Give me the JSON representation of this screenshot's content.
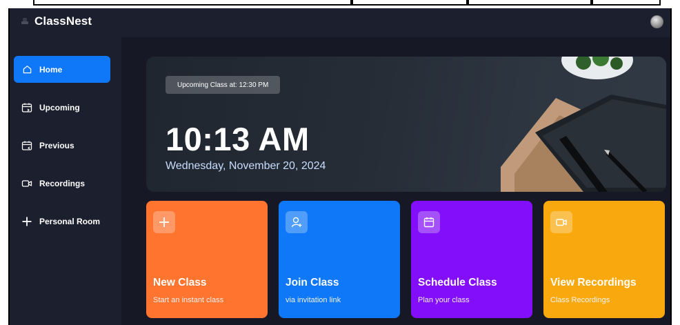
{
  "app": {
    "name": "ClassNest"
  },
  "colors": {
    "background": "#1c1f2e",
    "main_background": "#161925",
    "accent_blue": "#0e78f9",
    "card_orange": "#ff742e",
    "card_blue": "#0e78f9",
    "card_purple": "#830ef9",
    "card_yellow": "#f9a90e"
  },
  "sidebar": {
    "items": [
      {
        "label": "Home",
        "icon": "home-icon"
      },
      {
        "label": "Upcoming",
        "icon": "calendar-upcoming-icon"
      },
      {
        "label": "Previous",
        "icon": "calendar-previous-icon"
      },
      {
        "label": "Recordings",
        "icon": "video-icon"
      },
      {
        "label": "Personal Room",
        "icon": "plus-icon"
      }
    ]
  },
  "hero": {
    "upcoming": "Upcoming Class at: 12:30 PM",
    "time": "10:13 AM",
    "date": "Wednesday, November 20, 2024"
  },
  "cards": [
    {
      "title": "New Class",
      "subtitle": "Start an instant class",
      "icon": "plus-icon"
    },
    {
      "title": "Join Class",
      "subtitle": "via invitation link",
      "icon": "user-add-icon"
    },
    {
      "title": "Schedule Class",
      "subtitle": "Plan your class",
      "icon": "calendar-icon"
    },
    {
      "title": "View Recordings",
      "subtitle": "Class Recordings",
      "icon": "video-icon"
    }
  ]
}
